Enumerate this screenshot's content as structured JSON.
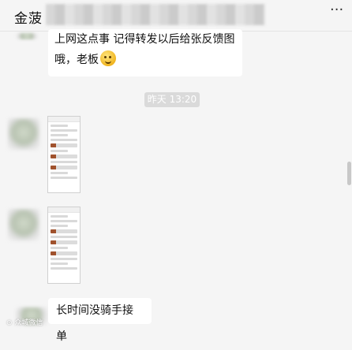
{
  "header": {
    "title": "金菠",
    "more_icon": "ellipsis-icon"
  },
  "messages": [
    {
      "line1": "上网这点事 记得转发以后给张反馈图",
      "line2": "哦，老板",
      "emoji": "grinning-face-icon"
    }
  ],
  "timestamp": "昨天 13:20",
  "last_message": "长时间没骑手接单",
  "watermark": "⊙ 众城微信"
}
